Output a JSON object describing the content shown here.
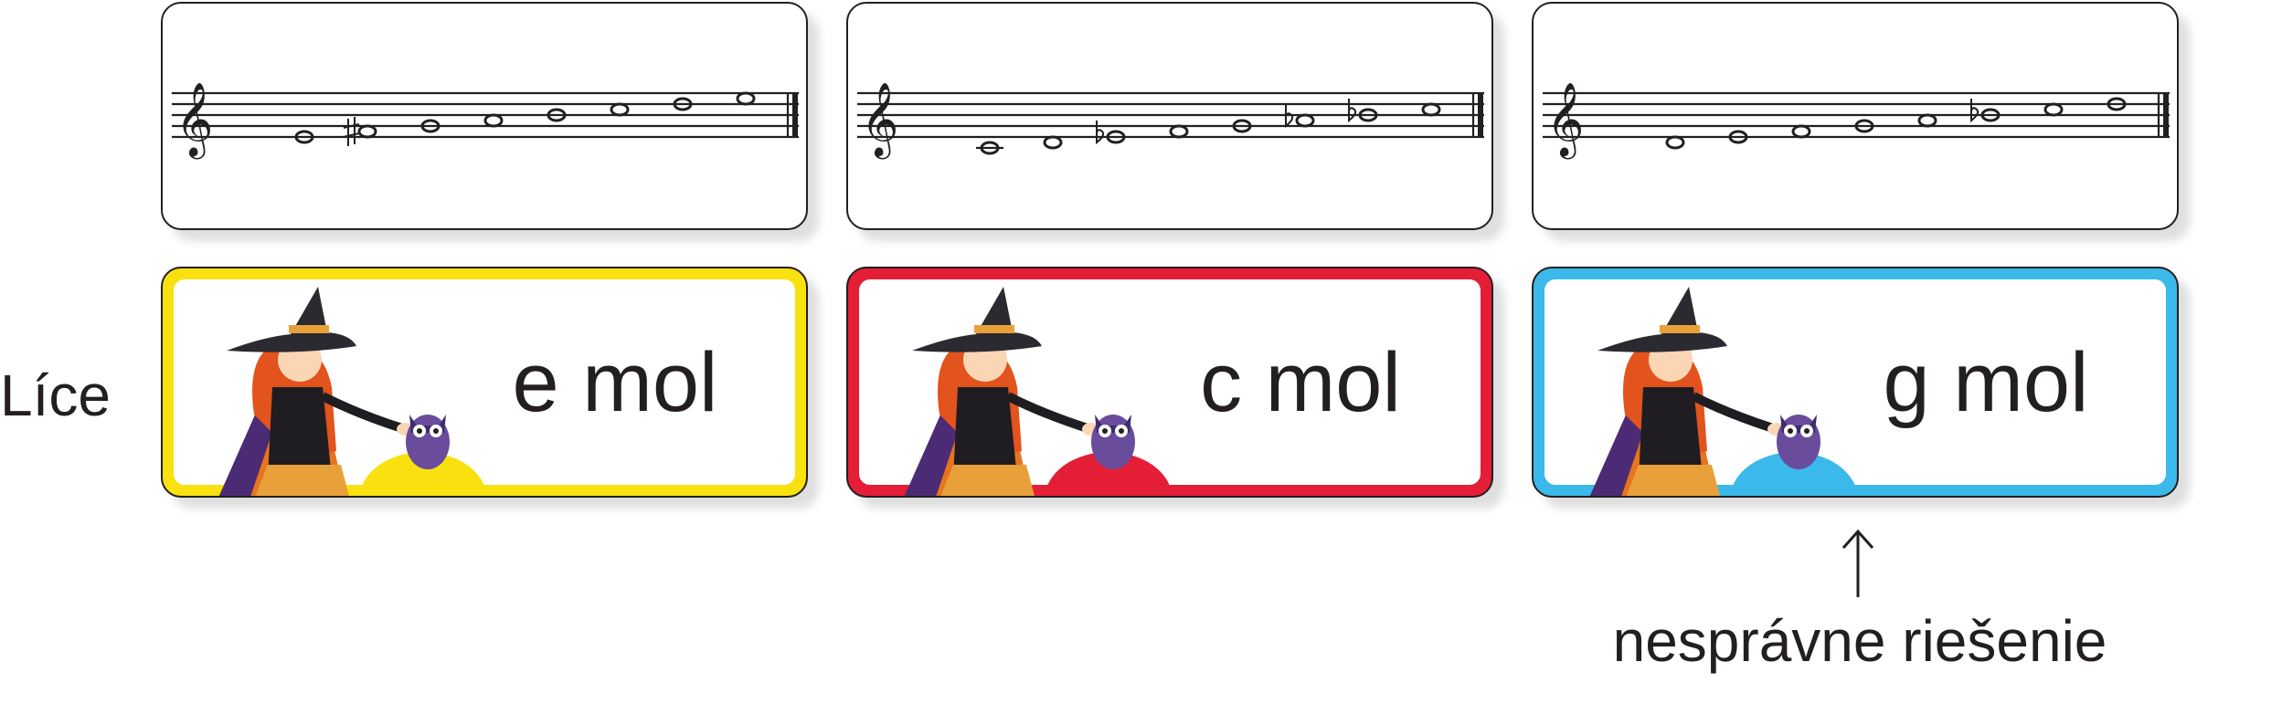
{
  "side_label": "Líce",
  "key_cards": [
    {
      "label": "e mol",
      "color": "#f9e10f"
    },
    {
      "label": "c mol",
      "color": "#e31e36"
    },
    {
      "label": "g mol",
      "color": "#3bb9ea"
    }
  ],
  "staff_cards": [
    {
      "scale": "e minor (melodic)",
      "accidentals": [
        "none",
        "sharp",
        "none",
        "none",
        "none",
        "none",
        "none",
        "none"
      ]
    },
    {
      "scale": "c minor",
      "accidentals": [
        "none",
        "none",
        "flat",
        "none",
        "none",
        "flat",
        "flat",
        "none"
      ]
    },
    {
      "scale": "g minor",
      "accidentals": [
        "none",
        "none",
        "none",
        "none",
        "none",
        "flat",
        "none",
        "none"
      ]
    }
  ],
  "annotation": {
    "arrow_icon": "up-arrow",
    "text": "nesprávne riešenie"
  }
}
